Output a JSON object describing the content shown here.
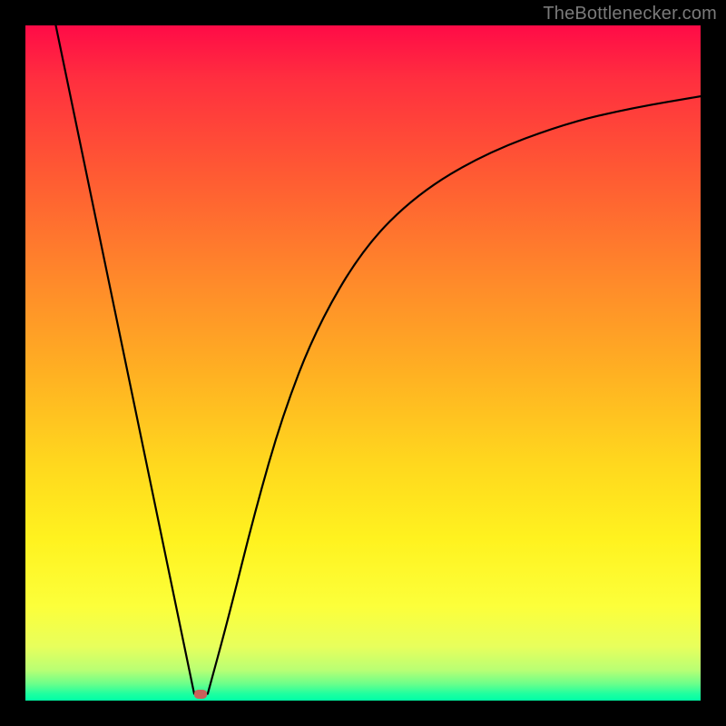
{
  "attribution": "TheBottlenecker.com",
  "colors": {
    "page_bg": "#000000",
    "attribution_text": "#7a7a7a",
    "curve_stroke": "#000000",
    "marker_fill": "#c9615a"
  },
  "chart_data": {
    "type": "line",
    "title": "",
    "xlabel": "",
    "ylabel": "",
    "xlim": [
      0,
      1
    ],
    "ylim": [
      0,
      1
    ],
    "legend": false,
    "grid": false,
    "axes_visible": false,
    "series": [
      {
        "name": "left-linear-descent",
        "x": [
          0.045,
          0.25
        ],
        "y": [
          1.0,
          0.01
        ]
      },
      {
        "name": "right-asymptotic-rise",
        "x": [
          0.27,
          0.3,
          0.34,
          0.38,
          0.43,
          0.5,
          0.58,
          0.68,
          0.8,
          0.9,
          1.0
        ],
        "y": [
          0.01,
          0.12,
          0.28,
          0.42,
          0.55,
          0.67,
          0.75,
          0.81,
          0.855,
          0.878,
          0.895
        ]
      }
    ],
    "annotations": [
      {
        "name": "minimum-marker",
        "shape": "ellipse",
        "x": 0.26,
        "y": 0.01,
        "color": "#c9615a"
      }
    ],
    "background_gradient": {
      "direction": "vertical",
      "stops": [
        {
          "pos": 0.0,
          "color": "#ff0b47"
        },
        {
          "pos": 0.38,
          "color": "#ff8a2a"
        },
        {
          "pos": 0.76,
          "color": "#fff21f"
        },
        {
          "pos": 0.96,
          "color": "#b8ff74"
        },
        {
          "pos": 1.0,
          "color": "#00ffa6"
        }
      ]
    }
  }
}
